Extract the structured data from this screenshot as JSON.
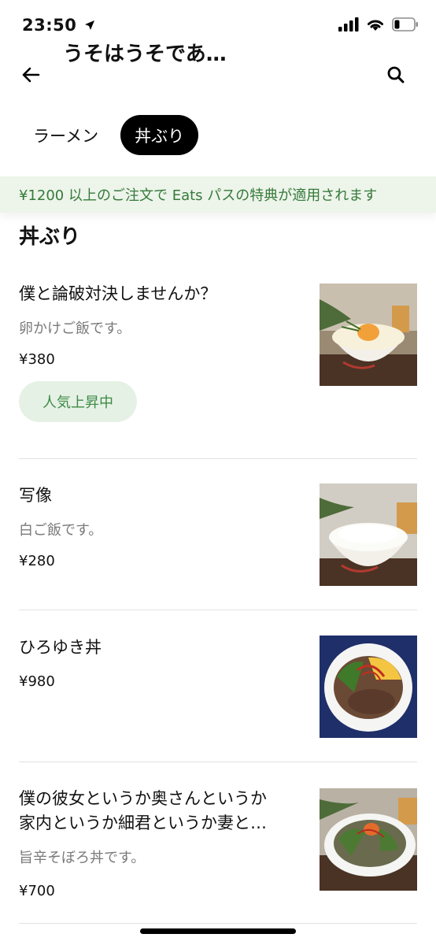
{
  "status": {
    "time": "23:50"
  },
  "header": {
    "title": "うそはうそであ…"
  },
  "tabs": [
    {
      "label": "ラーメン",
      "active": false
    },
    {
      "label": "丼ぶり",
      "active": true
    }
  ],
  "banner": {
    "text": "¥1200 以上のご注文で Eats パスの特典が適用されます"
  },
  "section": {
    "title": "丼ぶり"
  },
  "items": [
    {
      "name": "僕と論破対決しませんか？",
      "desc": "卵かけご飯です。",
      "price": "¥380",
      "badge": "人気上昇中"
    },
    {
      "name": "写像",
      "desc": "白ご飯です。",
      "price": "¥280"
    },
    {
      "name": "ひろゆき丼",
      "price": "¥980"
    },
    {
      "name_line1": "僕の彼女というか奥さんというか",
      "name_line2": "家内というか細君というか妻と…",
      "desc": "旨辛そぼろ丼です。",
      "price": "¥700"
    }
  ],
  "colors": {
    "accent_green": "#357a3a",
    "banner_bg": "#edf4ea",
    "badge_bg": "#e6f1e6"
  }
}
